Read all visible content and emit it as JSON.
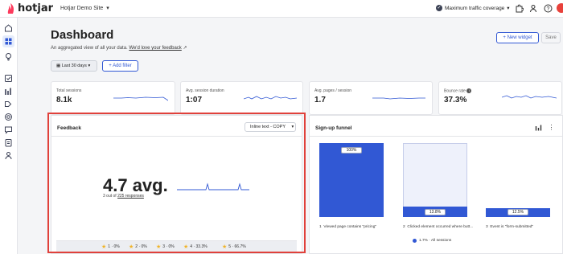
{
  "app": {
    "logo_text": "hotjar",
    "site": "Hotjar Demo Site",
    "coverage": "Maximum traffic coverage"
  },
  "header": {
    "title": "Dashboard",
    "subtitle": "An aggregated view of all your data.",
    "feedback_link": "We'd love your feedback",
    "new_widget": "+ New widget",
    "save": "Save"
  },
  "filters": {
    "date_range": "Last 30 days",
    "add_filter": "+ Add filter"
  },
  "metrics": [
    {
      "label": "Total sessions",
      "value": "8.1k"
    },
    {
      "label": "Avg. session duration",
      "value": "1:07"
    },
    {
      "label": "Avg. pages / session",
      "value": "1.7"
    },
    {
      "label": "Bounce rate",
      "value": "37.3%"
    }
  ],
  "feedback": {
    "title": "Feedback",
    "widget_select": "Inline text - COPY",
    "avg_value": "4.7 avg.",
    "responses_prefix": "3 out of",
    "responses_link": "225 responses",
    "ratings": [
      {
        "label": "1 · 0%"
      },
      {
        "label": "2 · 0%"
      },
      {
        "label": "3 · 0%"
      },
      {
        "label": "4 · 33.3%"
      },
      {
        "label": "5 · 66.7%"
      }
    ]
  },
  "funnel": {
    "title": "Sign-up funnel",
    "steps": [
      {
        "num": "1",
        "label": "Viewed page contains \"pricing\"",
        "percent": "100%",
        "fill": 1.0
      },
      {
        "num": "2",
        "label": "Clicked element occurred where butt...",
        "percent": "13.8%",
        "fill": 0.138
      },
      {
        "num": "3",
        "label": "Event is \"form-submitted\"",
        "percent": "12.5%",
        "fill": 0.125
      }
    ],
    "legend": "1.7% · All sessions"
  },
  "colors": {
    "accent": "#3158d4",
    "highlight": "#e0413b",
    "star": "#f0b429"
  },
  "icons": {
    "nav": [
      "home-icon",
      "dashboard-icon",
      "lightbulb-icon",
      "checklist-icon",
      "bar-chart-icon",
      "recordings-icon",
      "target-icon",
      "chat-icon",
      "survey-icon",
      "users-icon"
    ],
    "top": [
      "puzzle-icon",
      "user-add-icon",
      "help-icon",
      "avatar"
    ]
  }
}
